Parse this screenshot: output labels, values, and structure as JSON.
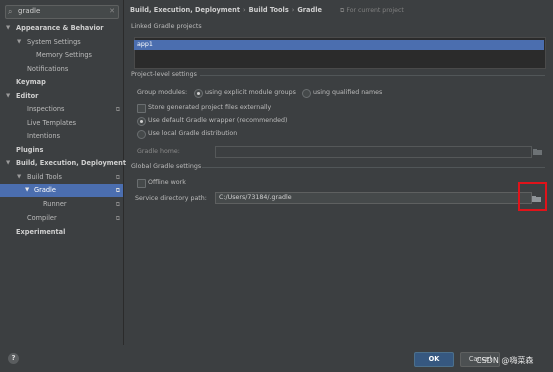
{
  "search": {
    "value": "gradle",
    "icon": "search-icon",
    "clear_icon": "close-icon"
  },
  "sidebar": {
    "items": [
      {
        "label": "Appearance & Behavior",
        "arrow": "▼"
      },
      {
        "label": "System Settings",
        "arrow": "▼"
      },
      {
        "label": "Memory Settings",
        "arrow": ""
      },
      {
        "label": "Notifications",
        "arrow": ""
      },
      {
        "label": "Keymap",
        "arrow": ""
      },
      {
        "label": "Editor",
        "arrow": "▼"
      },
      {
        "label": "Inspections",
        "arrow": ""
      },
      {
        "label": "Live Templates",
        "arrow": ""
      },
      {
        "label": "Intentions",
        "arrow": ""
      },
      {
        "label": "Plugins",
        "arrow": ""
      },
      {
        "label": "Build, Execution, Deployment",
        "arrow": "▼"
      },
      {
        "label": "Build Tools",
        "arrow": "▼"
      },
      {
        "label": "Gradle",
        "arrow": "▼"
      },
      {
        "label": "Runner",
        "arrow": ""
      },
      {
        "label": "Compiler",
        "arrow": ""
      },
      {
        "label": "Experimental",
        "arrow": ""
      }
    ]
  },
  "breadcrumb": {
    "part1": "Build, Execution, Deployment",
    "sep1": "›",
    "part2": "Build Tools",
    "sep2": "›",
    "part3": "Gradle"
  },
  "scope_note": "For current project",
  "linked_projects": {
    "title": "Linked Gradle projects",
    "items": [
      "app1"
    ]
  },
  "project_level": {
    "title": "Project-level settings",
    "group_modules_label": "Group modules:",
    "radio_explicit": "using explicit module groups",
    "radio_qualified": "using qualified names",
    "store_generated": "Store generated project files externally",
    "use_wrapper": "Use default Gradle wrapper (recommended)",
    "use_local": "Use local Gradle distribution",
    "gradle_home_label": "Gradle home:",
    "gradle_home_value": ""
  },
  "global": {
    "title": "Global Gradle settings",
    "offline_work": "Offline work",
    "service_dir_label": "Service directory path:",
    "service_dir_value": "C:/Users/73184/.gradle"
  },
  "footer": {
    "help": "?",
    "ok": "OK",
    "cancel": "Cancel"
  },
  "watermark": "CSDN @嗨菜森",
  "colors": {
    "selection": "#4b6eaf",
    "highlight": "#e0131a",
    "ok_button": "#365880"
  }
}
